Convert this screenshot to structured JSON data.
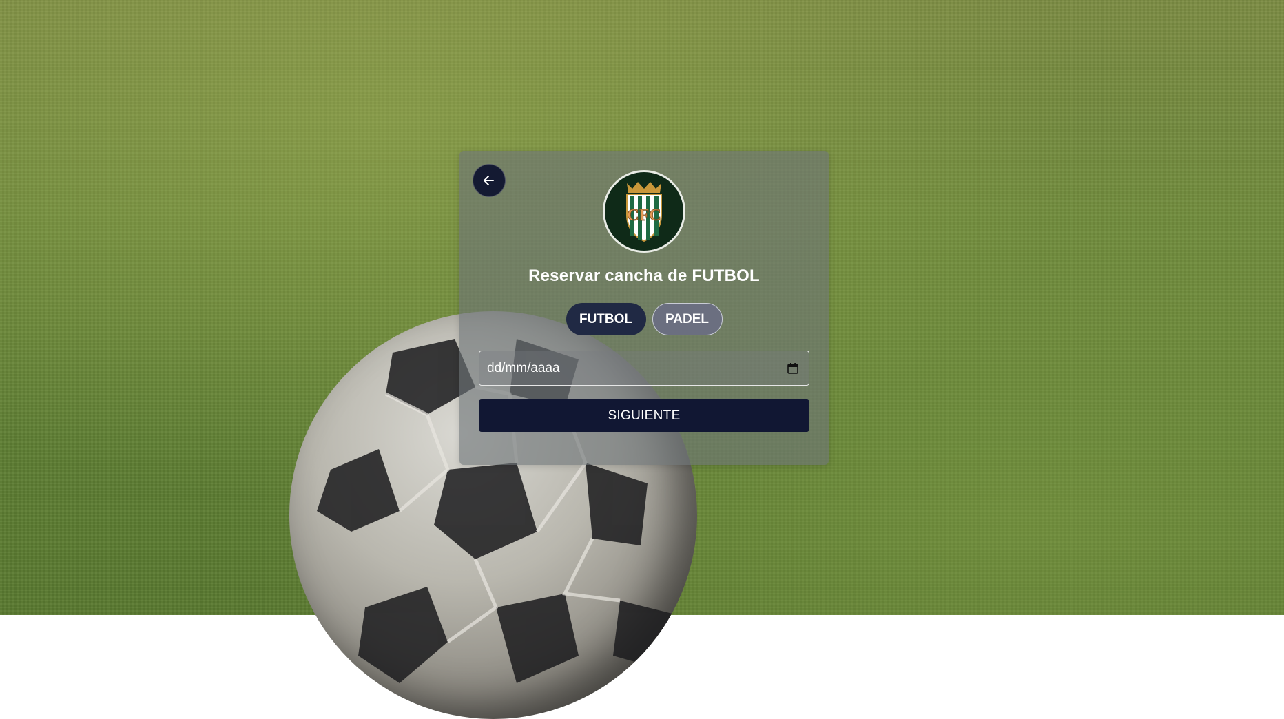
{
  "header": {
    "back_icon": "arrow-left-icon",
    "logo_icon": "club-crest-logo",
    "title": "Reservar cancha de FUTBOL"
  },
  "sports": {
    "items": [
      {
        "label": "FUTBOL",
        "selected": true
      },
      {
        "label": "PADEL",
        "selected": false
      }
    ]
  },
  "form": {
    "date_placeholder": "dd/mm/aaaa",
    "date_icon": "calendar-icon",
    "next_label": "SIGUIENTE"
  },
  "logo": {
    "text": "CFC"
  },
  "colors": {
    "primary_dark": "#111733",
    "tab_active": "#202944",
    "tab_inactive": "#6b6f80"
  }
}
